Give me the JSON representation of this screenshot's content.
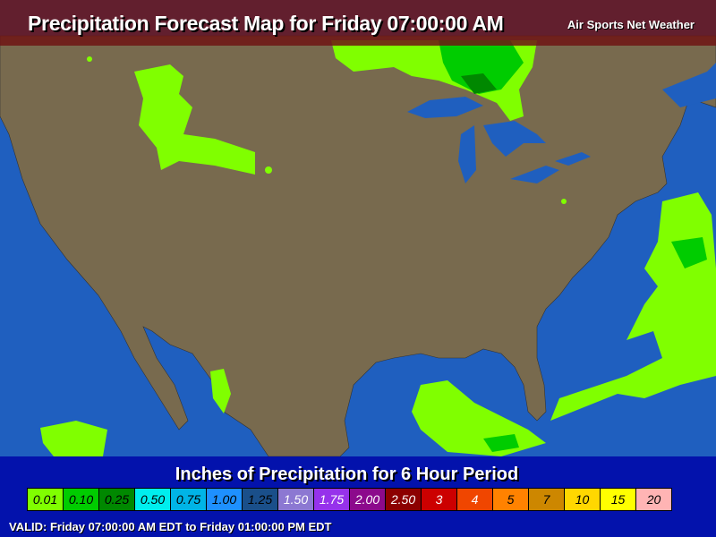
{
  "header": {
    "title": "Precipitation Forecast Map for Friday 07:00:00 AM",
    "brand": "Air Sports Net Weather"
  },
  "colors": {
    "ocean": "#1f5fbf",
    "land": "#786a4e",
    "header_band": "#6e1414",
    "footer_band": "#000aaa",
    "precip_light": "#80ff00"
  },
  "legend": {
    "title": "Inches of Precipitation for 6 Hour Period",
    "items": [
      {
        "label": "0.01",
        "color": "#80ff00",
        "text": "#000"
      },
      {
        "label": "0.10",
        "color": "#00cc00",
        "text": "#000"
      },
      {
        "label": "0.25",
        "color": "#008800",
        "text": "#000"
      },
      {
        "label": "0.50",
        "color": "#00eeee",
        "text": "#000"
      },
      {
        "label": "0.75",
        "color": "#00b4e6",
        "text": "#000"
      },
      {
        "label": "1.00",
        "color": "#1e90ff",
        "text": "#000"
      },
      {
        "label": "1.25",
        "color": "#1a4f8a",
        "text": "#000"
      },
      {
        "label": "1.50",
        "color": "#8c78d2",
        "text": "#fff"
      },
      {
        "label": "1.75",
        "color": "#9632eb",
        "text": "#fff"
      },
      {
        "label": "2.00",
        "color": "#8c0a8c",
        "text": "#fff"
      },
      {
        "label": "2.50",
        "color": "#8c0000",
        "text": "#fff"
      },
      {
        "label": "3",
        "color": "#cc0000",
        "text": "#fff"
      },
      {
        "label": "4",
        "color": "#f04600",
        "text": "#fff"
      },
      {
        "label": "5",
        "color": "#ff8200",
        "text": "#000"
      },
      {
        "label": "7",
        "color": "#cd8700",
        "text": "#000"
      },
      {
        "label": "10",
        "color": "#ffd700",
        "text": "#000"
      },
      {
        "label": "15",
        "color": "#ffff00",
        "text": "#000"
      },
      {
        "label": "20",
        "color": "#ffb4b4",
        "text": "#000"
      }
    ]
  },
  "footer": {
    "valid": "VALID: Friday 07:00:00 AM EDT to Friday 01:00:00 PM EDT"
  }
}
